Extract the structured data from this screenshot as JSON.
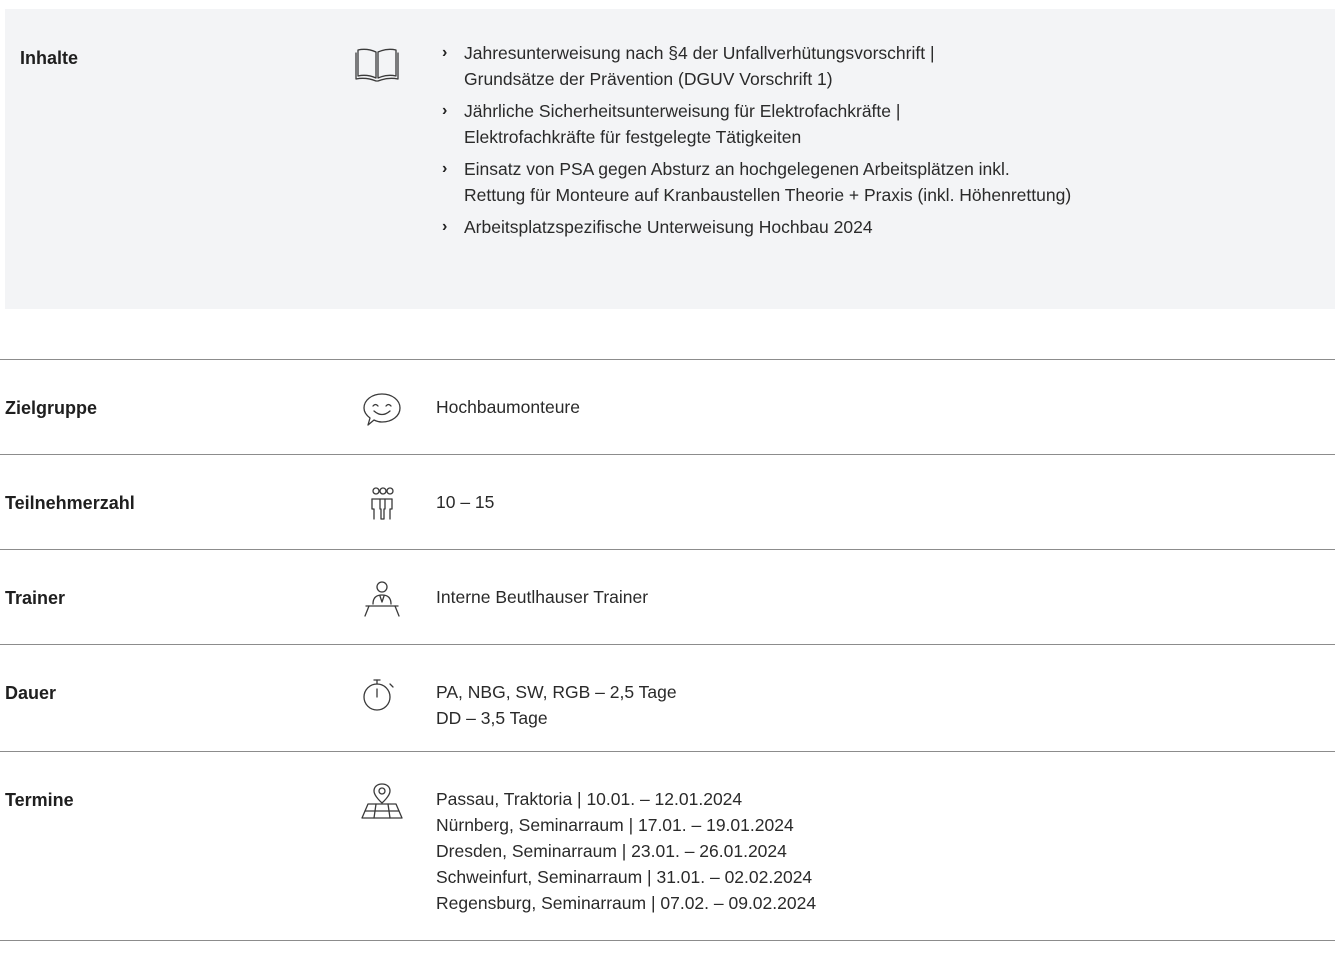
{
  "inhalte": {
    "label": "Inhalte",
    "icon": "book-icon",
    "items": [
      {
        "lines": [
          "Jahresunterweisung nach §4 der Unfallverhütungsvorschrift |",
          "Grundsätze der Prävention (DGUV Vorschrift 1)"
        ]
      },
      {
        "lines": [
          "Jährliche Sicherheitsunterweisung für Elektrofachkräfte |",
          "Elektrofachkräfte für festgelegte Tätigkeiten"
        ]
      },
      {
        "lines": [
          "Einsatz von PSA gegen Absturz an hochgelegenen Arbeitsplätzen inkl.",
          "Rettung für Monteure auf Kranbaustellen Theorie + Praxis (inkl. Höhenrettung)"
        ]
      },
      {
        "lines": [
          "Arbeitsplatzspezifische Unterweisung Hochbau 2024"
        ]
      }
    ]
  },
  "rows": [
    {
      "label": "Zielgruppe",
      "icon": "speech-bubble-smile-icon",
      "values": [
        "Hochbaumonteure"
      ]
    },
    {
      "label": "Teilnehmerzahl",
      "icon": "group-people-icon",
      "values": [
        "10 – 15"
      ]
    },
    {
      "label": "Trainer",
      "icon": "trainer-podium-icon",
      "values": [
        "Interne Beutlhauser Trainer"
      ]
    },
    {
      "label": "Dauer",
      "icon": "stopwatch-icon",
      "values": [
        "PA, NBG, SW, RGB – 2,5 Tage",
        "DD – 3,5 Tage"
      ]
    },
    {
      "label": "Termine",
      "icon": "map-pin-icon",
      "values": [
        "Passau, Traktoria | 10.01. – 12.01.2024",
        "Nürnberg, Seminarraum | 17.01. – 19.01.2024",
        "Dresden, Seminarraum | 23.01. – 26.01.2024",
        "Schweinfurt, Seminarraum | 31.01. – 02.02.2024",
        "Regensburg, Seminarraum | 07.02. – 09.02.2024"
      ]
    }
  ]
}
